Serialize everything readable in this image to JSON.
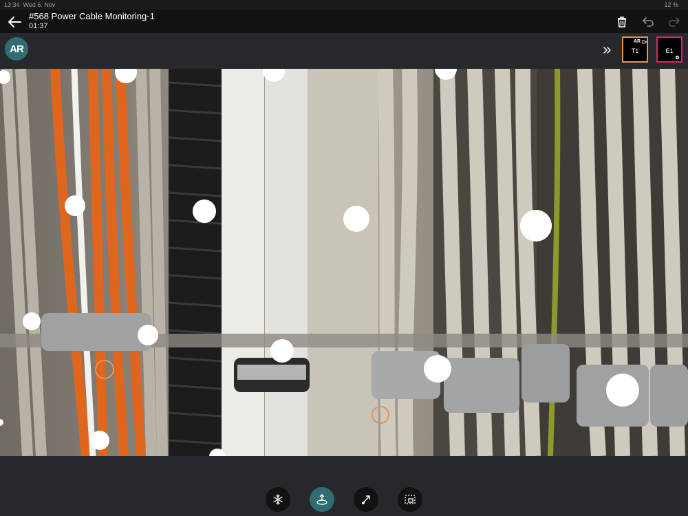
{
  "status_bar": {
    "time": "13:34",
    "date": "Wed 6. Nov",
    "battery": "12 %"
  },
  "header": {
    "title": "#568 Power Cable Monitoring-1",
    "timer": "01:37"
  },
  "toolbar": {
    "delete_icon": "trash-icon",
    "undo_icon": "undo-icon",
    "redo_icon": "redo-icon"
  },
  "subbar": {
    "logo_text": "AR",
    "thumbnails": [
      {
        "label": "T1",
        "badge": "AR",
        "border_color": "#e0955c"
      },
      {
        "label": "E1",
        "border_color": "#e0206a"
      }
    ]
  },
  "markers": {
    "ring_color": "#e0955c",
    "ring_count": 2,
    "dot_count": 18
  },
  "bottom_tools": [
    {
      "name": "freeze-icon",
      "active": false
    },
    {
      "name": "place-marker-icon",
      "active": true
    },
    {
      "name": "draw-arrow-icon",
      "active": false
    },
    {
      "name": "capture-icon",
      "active": false
    }
  ]
}
